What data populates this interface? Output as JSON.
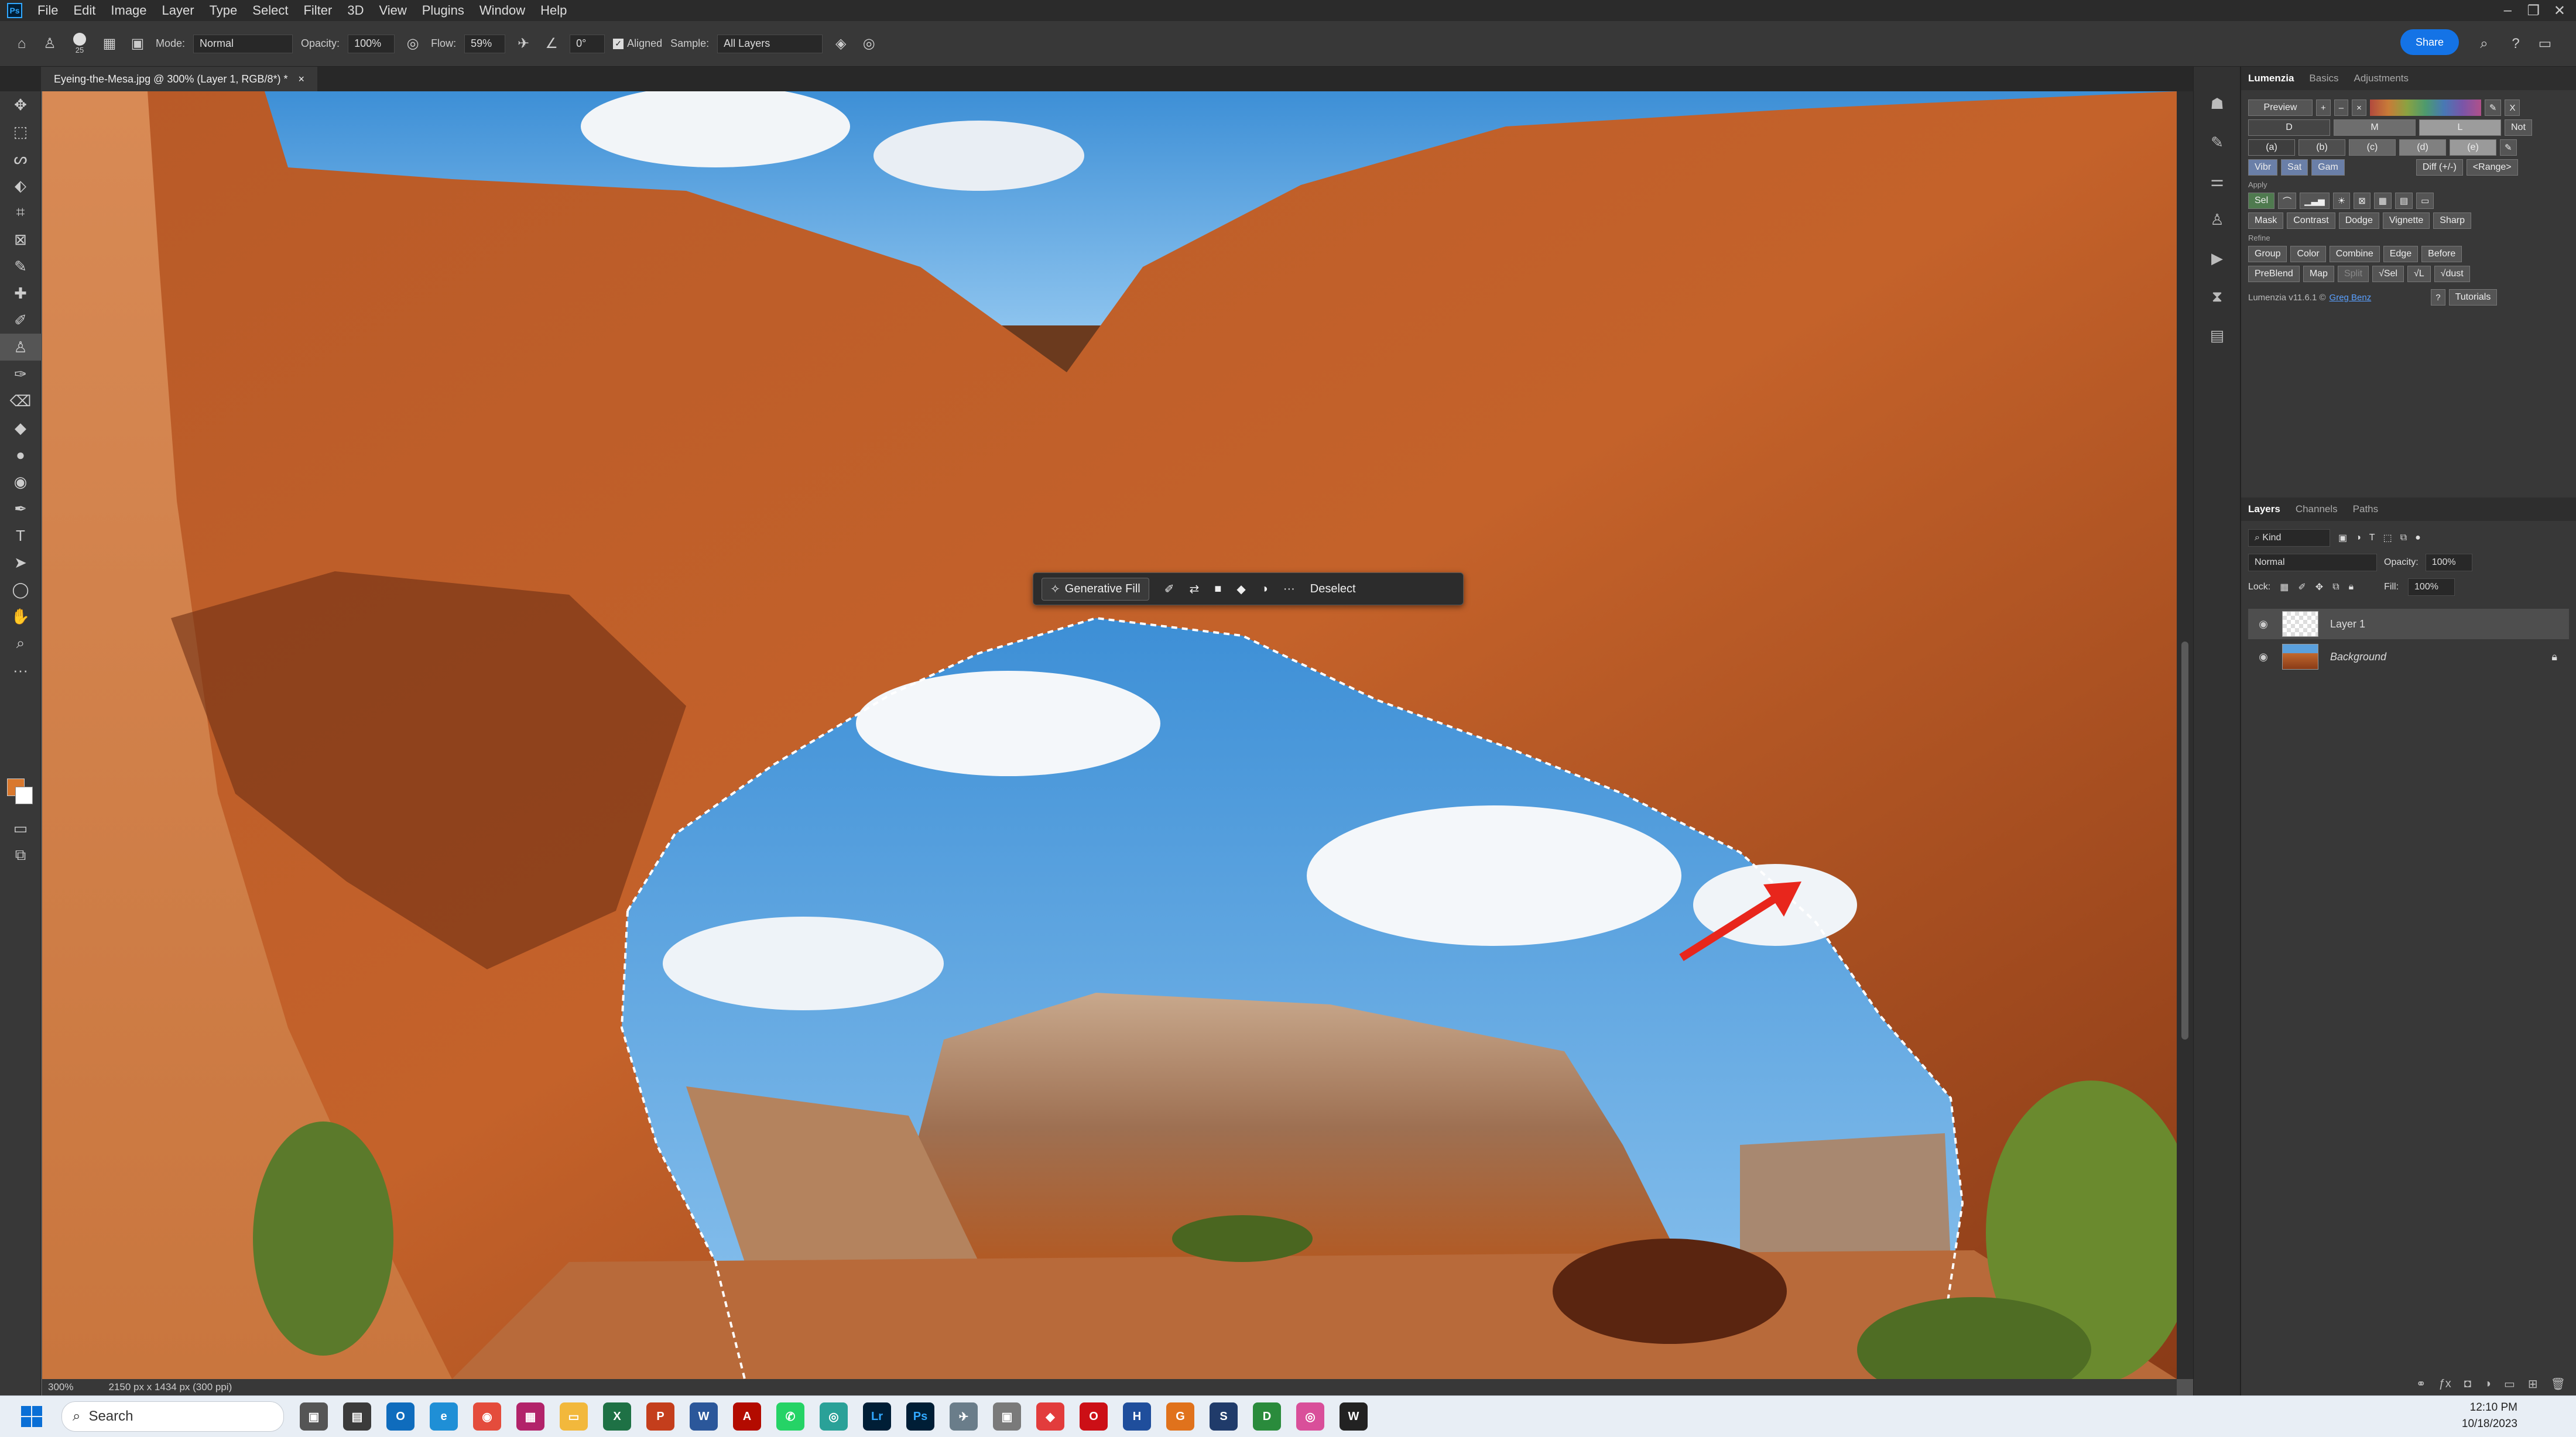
{
  "menubar": {
    "app_logo": "Ps",
    "items": [
      "File",
      "Edit",
      "Image",
      "Layer",
      "Type",
      "Select",
      "Filter",
      "3D",
      "View",
      "Plugins",
      "Window",
      "Help"
    ]
  },
  "options": {
    "brush_size": "25",
    "mode_label": "Mode:",
    "mode_value": "Normal",
    "opacity_label": "Opacity:",
    "opacity_value": "100%",
    "flow_label": "Flow:",
    "flow_value": "59%",
    "angle_value": "0°",
    "aligned_label": "Aligned",
    "sample_label": "Sample:",
    "sample_value": "All Layers",
    "share_label": "Share"
  },
  "document": {
    "tab_title": "Eyeing-the-Mesa.jpg @ 300% (Layer 1, RGB/8*) *",
    "close": "×"
  },
  "context_bar": {
    "generative_fill": "Generative Fill",
    "more": "···",
    "deselect": "Deselect"
  },
  "lumenzia": {
    "tabs": [
      "Lumenzia",
      "Basics",
      "Adjustments"
    ],
    "preview": "Preview",
    "not_label": "Not",
    "x_label": "X",
    "zones": [
      "D",
      "M",
      "L"
    ],
    "letters": [
      "(a)",
      "(b)",
      "(c)",
      "(d)",
      "(e)"
    ],
    "vsg": [
      "Vibr",
      "Sat",
      "Gam"
    ],
    "diff": "Diff (+/-)",
    "range": "<Range>",
    "apply_label": "Apply",
    "sel_label": "Sel",
    "apply_row": [
      "Mask",
      "Contrast",
      "Dodge",
      "Vignette",
      "Sharp"
    ],
    "refine_label": "Refine",
    "refine_row1": [
      "Group",
      "Color",
      "Combine",
      "Edge",
      "Before"
    ],
    "refine_row2": [
      "PreBlend",
      "Map",
      "Split",
      "Sel",
      "L",
      "dust"
    ],
    "version": "Lumenzia v11.6.1 ©",
    "author": "Greg Benz",
    "help": "?",
    "tutorials": "Tutorials"
  },
  "layers_panel": {
    "tabs": [
      "Layers",
      "Channels",
      "Paths"
    ],
    "kind": "Kind",
    "blend_mode": "Normal",
    "opacity_label": "Opacity:",
    "opacity_value": "100%",
    "lock_label": "Lock:",
    "fill_label": "Fill:",
    "fill_value": "100%",
    "layers": [
      {
        "name": "Layer 1",
        "selected": true
      },
      {
        "name": "Background",
        "selected": false
      }
    ]
  },
  "statusbar": {
    "zoom": "300%",
    "doc_info": "2150 px x 1434 px (300 ppi)"
  },
  "taskbar": {
    "search_label": "Search",
    "time": "12:10 PM",
    "date": "10/18/2023"
  },
  "colors": {
    "foreground": "#d9782e",
    "background": "#ffffff",
    "accent": "#1473e6",
    "selection_arrow": "#e8261c"
  }
}
